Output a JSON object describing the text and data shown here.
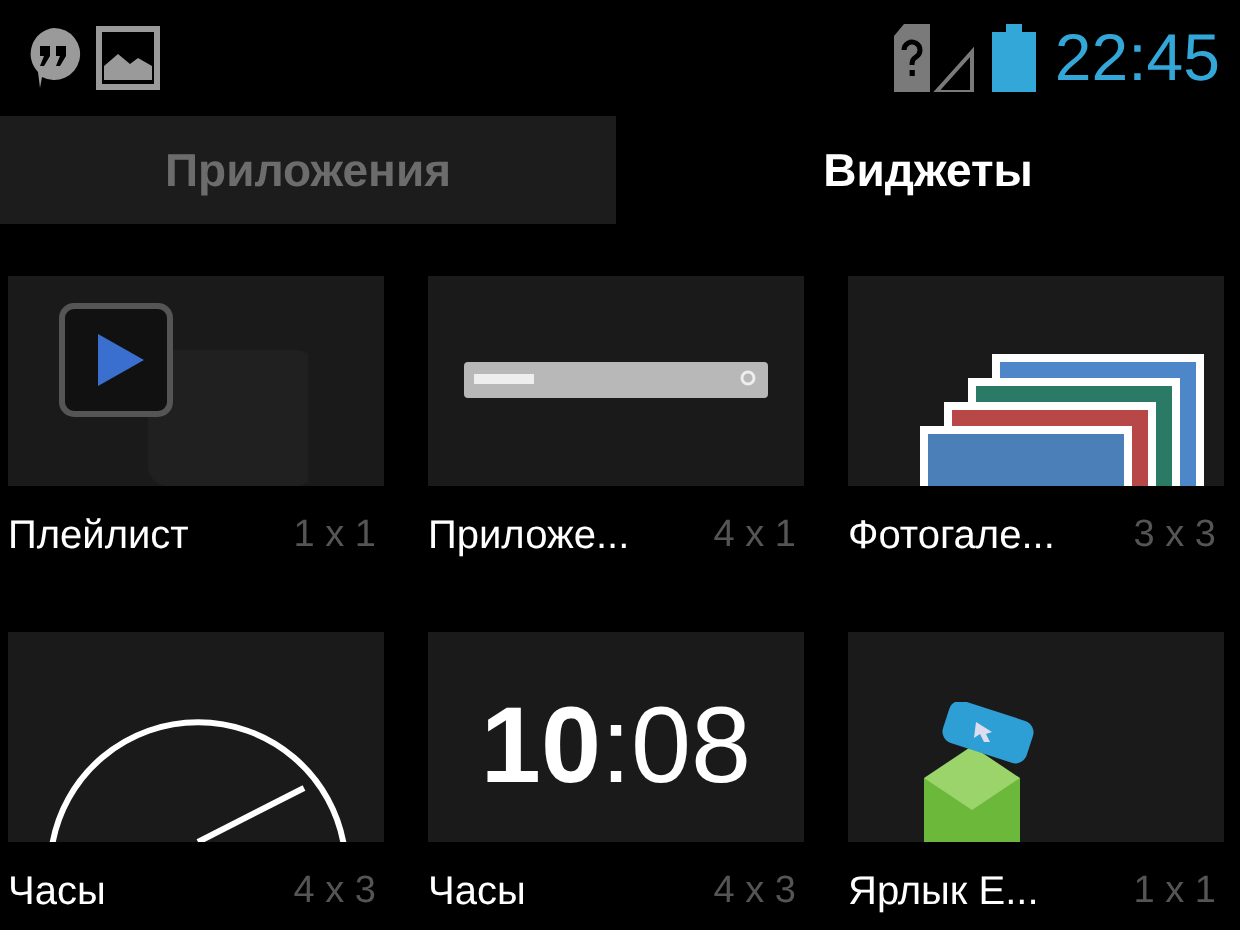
{
  "status_bar": {
    "time": "22:45"
  },
  "tabs": [
    {
      "label": "Приложения",
      "selected": false
    },
    {
      "label": "Виджеты",
      "selected": true
    }
  ],
  "widgets": [
    {
      "name": "Плейлист",
      "size": "1 x 1",
      "kind": "playlist"
    },
    {
      "name": "Приложе...",
      "size": "4 x 1",
      "kind": "search"
    },
    {
      "name": "Фотогале...",
      "size": "3 x 3",
      "kind": "gallery"
    },
    {
      "name": "Часы",
      "size": "4 x 3",
      "kind": "analog-clock"
    },
    {
      "name": "Часы",
      "size": "4 x 3",
      "kind": "digital-clock",
      "hours": "10",
      "minutes": ":08"
    },
    {
      "name": "Ярлык E...",
      "size": "1 x 1",
      "kind": "shortcut"
    }
  ]
}
